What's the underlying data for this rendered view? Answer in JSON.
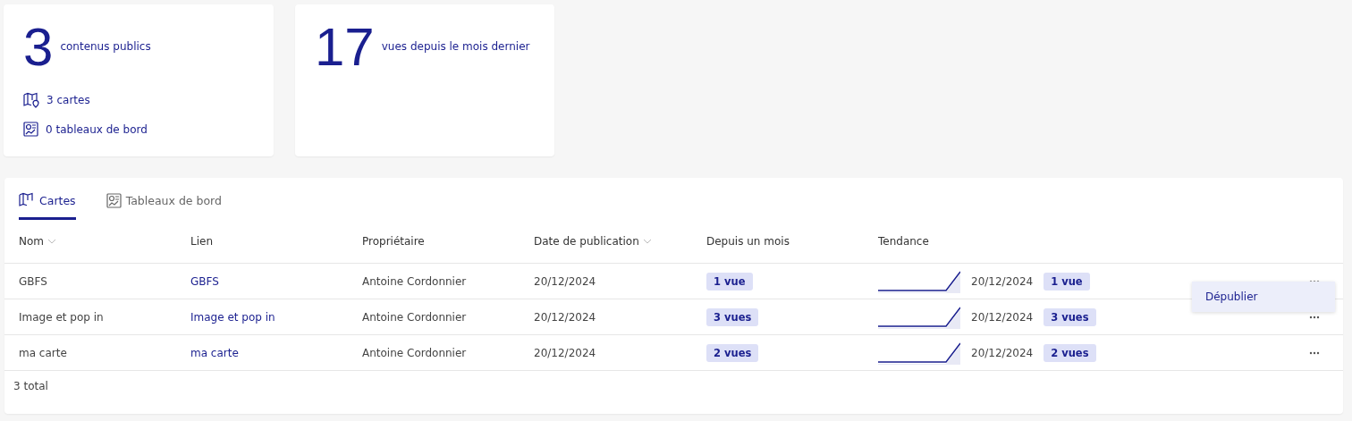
{
  "stats": [
    {
      "value": "3",
      "label": "contenus publics",
      "items": [
        {
          "kind": "map",
          "text": "3 cartes"
        },
        {
          "kind": "dashboard",
          "text": "0 tableaux de bord"
        }
      ]
    },
    {
      "value": "17",
      "label": "vues depuis le mois dernier"
    }
  ],
  "tabs": [
    {
      "kind": "map",
      "label": "Cartes",
      "selected": true
    },
    {
      "kind": "dashboard",
      "label": "Tableaux de bord",
      "selected": false
    }
  ],
  "columns": [
    {
      "label": "Nom",
      "sortable": true
    },
    {
      "label": "Lien",
      "sortable": false
    },
    {
      "label": "Propriétaire",
      "sortable": false
    },
    {
      "label": "Date de publication",
      "sortable": true
    },
    {
      "label": "Depuis un mois",
      "sortable": false
    },
    {
      "label": "Tendance",
      "sortable": false
    }
  ],
  "rows": [
    {
      "name": "GBFS",
      "link": "GBFS",
      "owner": "Antoine Cordonnier",
      "date": "20/12/2024",
      "views": "1 vue",
      "trend_date": "20/12/2024",
      "trend_views": "1 vue",
      "menu_open": true
    },
    {
      "name": "Image et pop in",
      "link": "Image et pop in",
      "owner": "Antoine Cordonnier",
      "date": "20/12/2024",
      "views": "3 vues",
      "trend_date": "20/12/2024",
      "trend_views": "3 vues",
      "menu_open": false
    },
    {
      "name": "ma carte",
      "link": "ma carte",
      "owner": "Antoine Cordonnier",
      "date": "20/12/2024",
      "views": "2 vues",
      "trend_date": "20/12/2024",
      "trend_views": "2 vues",
      "menu_open": false
    }
  ],
  "menu": {
    "items": [
      "Dépublier"
    ]
  },
  "footer": "3 total"
}
